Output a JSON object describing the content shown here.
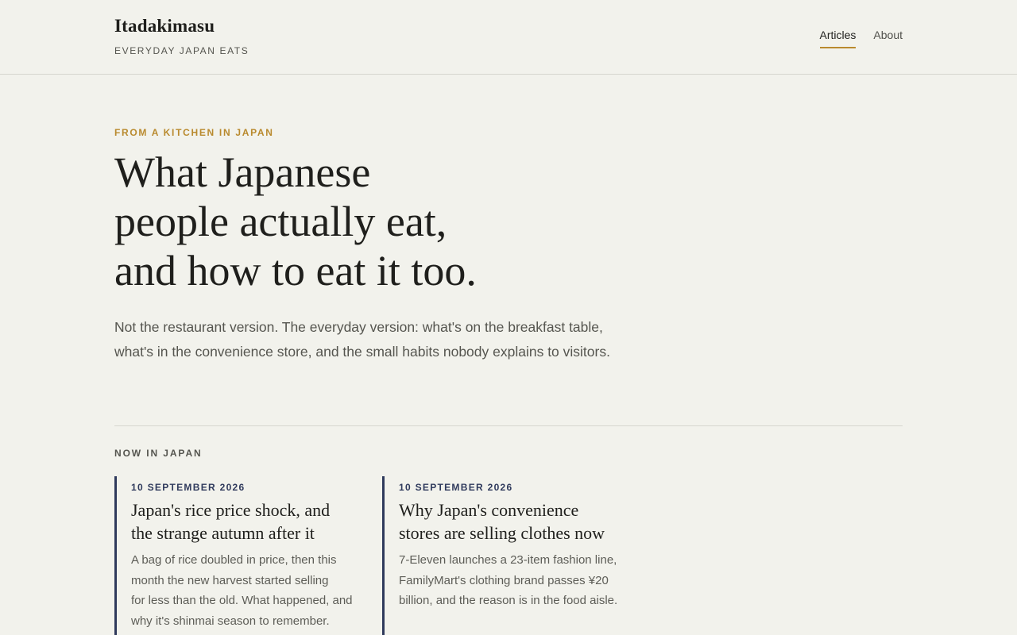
{
  "brand": {
    "title": "Itadakimasu",
    "tagline": "EVERYDAY JAPAN EATS"
  },
  "nav": {
    "items": [
      {
        "label": "Articles",
        "active": true
      },
      {
        "label": "About",
        "active": false
      }
    ]
  },
  "hero": {
    "eyebrow": "FROM A KITCHEN IN JAPAN",
    "title_lines": [
      "What Japanese",
      "people actually eat,",
      "and how to eat it too."
    ],
    "lede": "Not the restaurant version. The everyday version: what's on the breakfast table, what's in the convenience store, and the small habits nobody explains to visitors."
  },
  "section": {
    "label": "NOW IN JAPAN"
  },
  "articles": [
    {
      "date": "10 SEPTEMBER 2026",
      "title_lines": [
        "Japan's rice price shock, and",
        "the strange autumn after it"
      ],
      "excerpt_lines": [
        "A bag of rice doubled in price, then this",
        "month the new harvest started selling",
        "for less than the old. What happened, and",
        "why it's shinmai season to remember."
      ]
    },
    {
      "date": "10 SEPTEMBER 2026",
      "title_lines": [
        "Why Japan's convenience",
        "stores are selling clothes now"
      ],
      "excerpt_lines": [
        "7-Eleven launches a 23-item fashion line,",
        "FamilyMart's clothing brand passes ¥20",
        "billion, and the reason is in the food aisle."
      ]
    }
  ],
  "colors": {
    "background": "#f2f2ec",
    "accent": "#b98a2e",
    "navy": "#2f3a5c"
  }
}
